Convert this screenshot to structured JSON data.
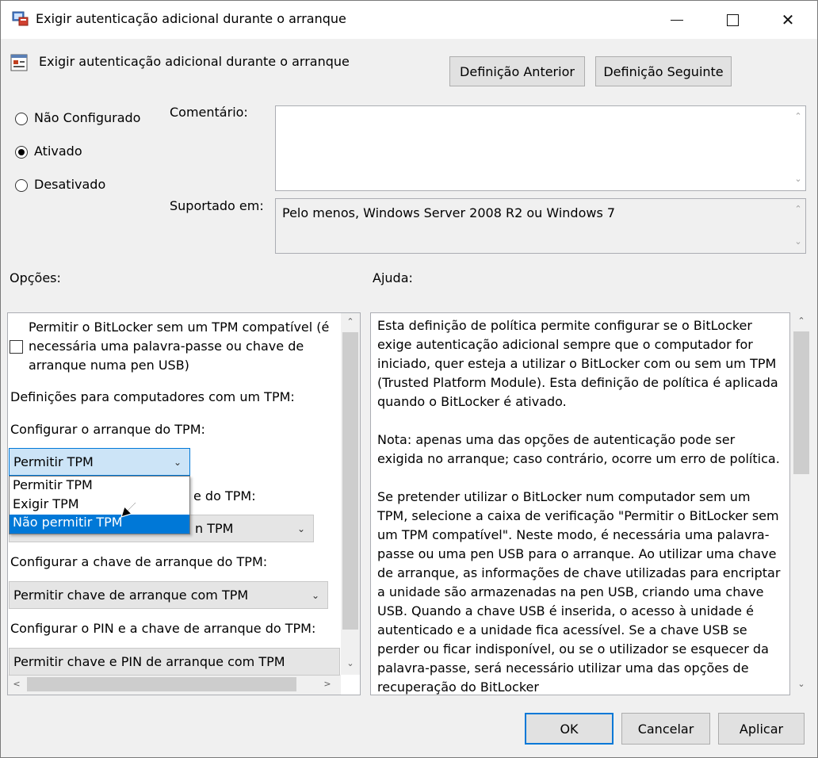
{
  "window": {
    "title": "Exigir autenticação adicional durante o arranque",
    "minimize": "—",
    "maximize": "☐",
    "close": "✕"
  },
  "header": {
    "policy_name": "Exigir autenticação adicional durante o arranque",
    "prev_button": "Definição Anterior",
    "next_button": "Definição Seguinte"
  },
  "state": {
    "options": [
      {
        "label": "Não Configurado",
        "selected": false
      },
      {
        "label": "Ativado",
        "selected": true
      },
      {
        "label": "Desativado",
        "selected": false
      }
    ]
  },
  "comment": {
    "label": "Comentário:",
    "value": ""
  },
  "supported": {
    "label": "Suportado em:",
    "value": "Pelo menos, Windows Server 2008 R2 ou Windows 7"
  },
  "options_panel": {
    "title": "Opções:",
    "checkbox_label_1": "Permitir o BitLocker sem um TPM compatível (é",
    "checkbox_label_2": "necessária uma palavra-passe ou chave de",
    "checkbox_label_3": "arranque numa pen USB)",
    "checkbox_checked": false,
    "tpm_heading": "Definições para computadores com um TPM:",
    "tpm_startup_label": "Configurar o arranque do TPM:",
    "tpm_startup_value": "Permitir TPM",
    "dropdown_options": [
      "Permitir TPM",
      "Exigir TPM",
      "Não permitir TPM"
    ],
    "hidden_label_tail": "e do TPM:",
    "hidden_combo_tail": "n TPM",
    "startup_key_label": "Configurar a chave de arranque do TPM:",
    "startup_key_value": "Permitir chave de arranque com TPM",
    "pin_key_label": "Configurar o PIN e a chave de arranque do TPM:",
    "pin_key_value": "Permitir chave e PIN de arranque com TPM"
  },
  "help_panel": {
    "title": "Ajuda:",
    "paragraphs": [
      "Esta definição de política permite configurar se o BitLocker exige autenticação adicional sempre que o computador for iniciado, quer esteja a utilizar o BitLocker com ou sem um TPM (Trusted Platform Module). Esta definição de política é aplicada quando o BitLocker é ativado.",
      "Nota: apenas uma das opções de autenticação pode ser exigida no arranque; caso contrário, ocorre um erro de política.",
      "Se pretender utilizar o BitLocker num computador sem um TPM, selecione a caixa de verificação \"Permitir o BitLocker sem um TPM compatível\". Neste modo, é necessária uma palavra-passe ou uma pen USB para o arranque. Ao utilizar uma chave de arranque, as informações de chave utilizadas para encriptar a unidade são armazenadas na pen USB, criando uma chave USB. Quando a chave USB é inserida, o acesso à unidade é autenticado e a unidade fica acessível. Se a chave USB se perder ou ficar indisponível, ou se o utilizador se esquecer da palavra-passe, será necessário utilizar uma das opções de recuperação do BitLocker"
    ]
  },
  "footer": {
    "ok": "OK",
    "cancel": "Cancelar",
    "apply": "Aplicar"
  },
  "icons": {
    "scroll_up": "⌃",
    "scroll_down": "⌄",
    "scroll_left": "<",
    "scroll_right": ">",
    "chevron": "⌄"
  }
}
